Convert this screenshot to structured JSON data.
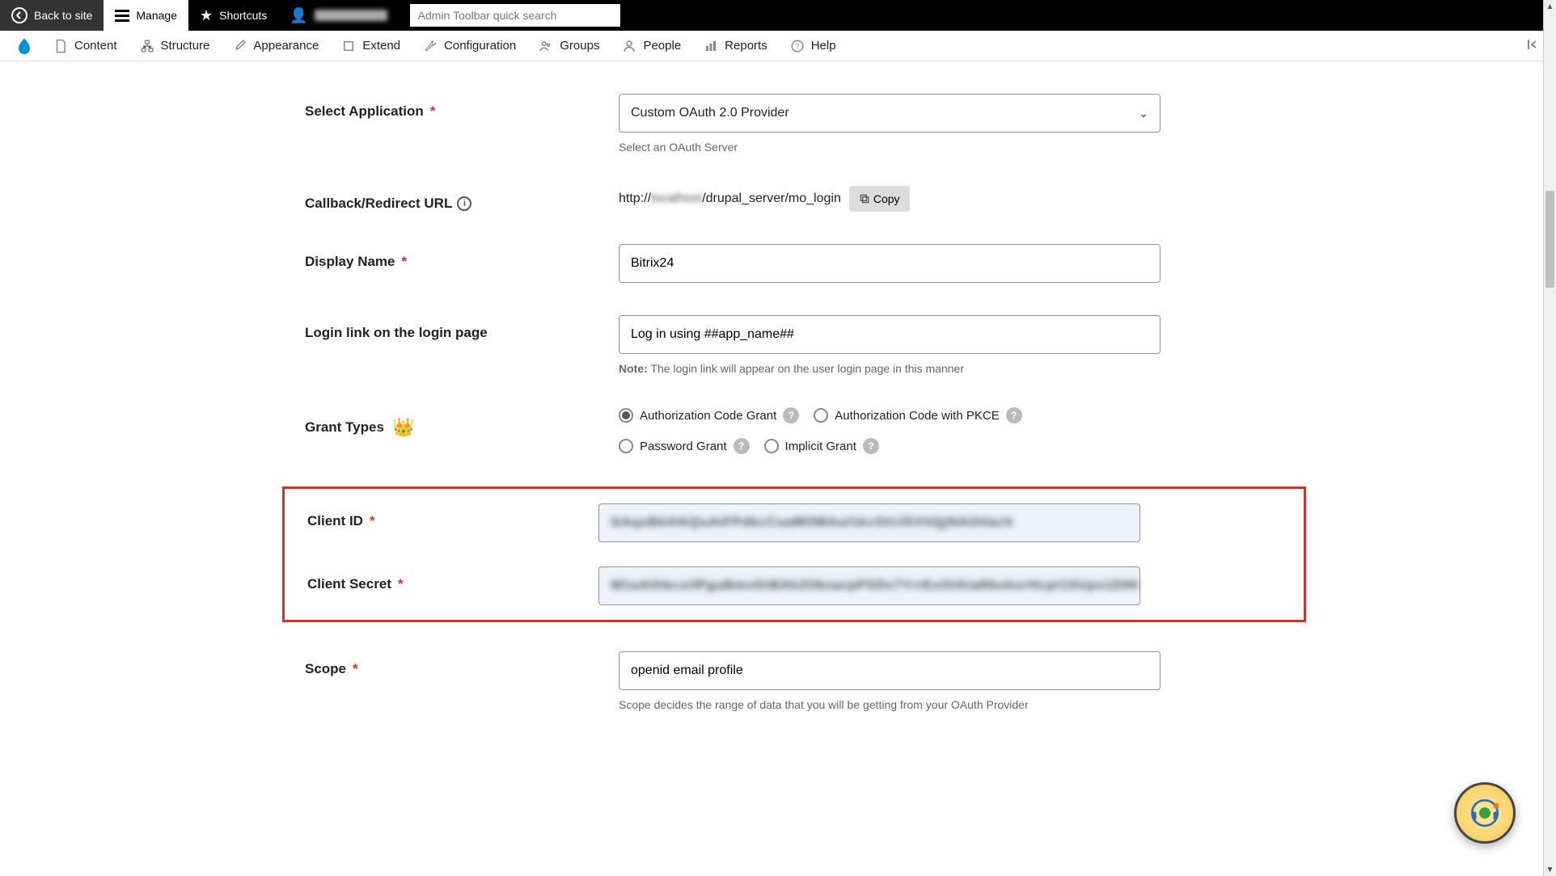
{
  "toolbar": {
    "back": "Back to site",
    "manage": "Manage",
    "shortcuts": "Shortcuts",
    "search_placeholder": "Admin Toolbar quick search"
  },
  "menu": {
    "content": "Content",
    "structure": "Structure",
    "appearance": "Appearance",
    "extend": "Extend",
    "configuration": "Configuration",
    "groups": "Groups",
    "people": "People",
    "reports": "Reports",
    "help": "Help"
  },
  "form": {
    "select_app": {
      "label": "Select Application",
      "value": "Custom OAuth 2.0 Provider",
      "help": "Select an OAuth Server"
    },
    "callback": {
      "label": "Callback/Redirect URL",
      "prefix": "http://",
      "host": "localhost",
      "path": "/drupal_server/mo_login",
      "copy": "Copy"
    },
    "display_name": {
      "label": "Display Name",
      "value": "Bitrix24"
    },
    "login_link": {
      "label": "Login link on the login page",
      "value": "Log in using ##app_name##",
      "note_prefix": "Note:",
      "note_text": "The login link will appear on the user login page in this manner"
    },
    "grant_types": {
      "label": "Grant Types",
      "options": [
        "Authorization Code Grant",
        "Authorization Code with PKCE",
        "Password Grant",
        "Implicit Grant"
      ]
    },
    "client_id": {
      "label": "Client ID",
      "value": "GAqxBkXtkQuAtFPdkcCuaMOMAuI1kcOUJSVttQjNAOtlach"
    },
    "client_secret": {
      "label": "Client Secret",
      "value": "W1aAthbcxilPguBmvGtBAk2OknarpPSDx7YrrExOtAtaRbxkxrHcpt1SUpx1D90"
    },
    "scope": {
      "label": "Scope",
      "value": "openid email profile",
      "help": "Scope decides the range of data that you will be getting from your OAuth Provider"
    }
  }
}
